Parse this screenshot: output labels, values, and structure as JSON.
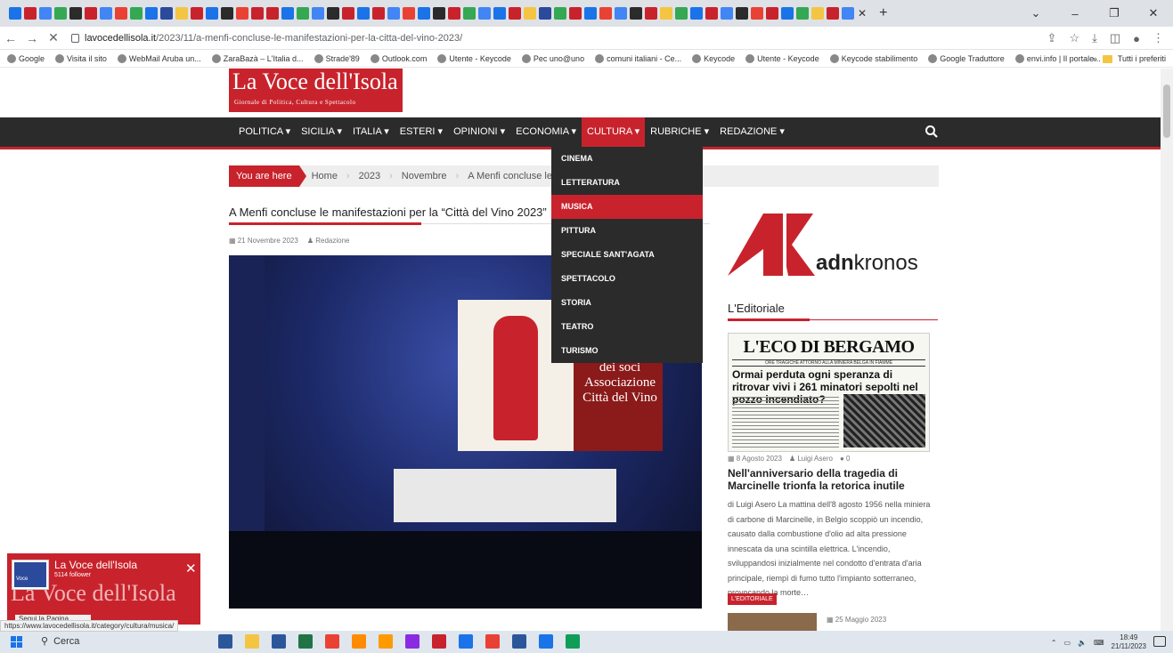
{
  "browser": {
    "url_domain": "lavocedellisola.it",
    "url_path": "/2023/11/a-menfi-concluse-le-manifestazioni-per-la-citta-del-vino-2023/",
    "tab_favicon_colors": [
      "#1a73e8",
      "#c8232c",
      "#4285f4",
      "#34a853",
      "#2b2b2b",
      "#c8232c",
      "#4285f4",
      "#e94235",
      "#34a853",
      "#1a73e8",
      "#2b4a9c",
      "#f4c542",
      "#c8232c",
      "#1a73e8",
      "#2b2b2b",
      "#e94235",
      "#c8232c",
      "#c8232c",
      "#1a73e8",
      "#34a853",
      "#4285f4",
      "#2b2b2b",
      "#c8232c",
      "#1a73e8",
      "#c8232c",
      "#4285f4",
      "#e94235",
      "#1a73e8",
      "#2b2b2b",
      "#c8232c",
      "#34a853",
      "#4285f4",
      "#1a73e8",
      "#c8232c",
      "#f4c542",
      "#2b4a9c",
      "#34a853",
      "#c8232c",
      "#1a73e8",
      "#e94235",
      "#4285f4",
      "#2b2b2b",
      "#c8232c",
      "#f4c542",
      "#34a853",
      "#1a73e8",
      "#c8232c",
      "#4285f4",
      "#2b2b2b",
      "#e94235",
      "#c8232c",
      "#1a73e8",
      "#34a853",
      "#f4c542",
      "#c8232c",
      "#4285f4"
    ],
    "bookmarks": [
      {
        "label": "Google"
      },
      {
        "label": "Visita il sito"
      },
      {
        "label": "WebMail Aruba un..."
      },
      {
        "label": "ZaraBazà – L'Italia d..."
      },
      {
        "label": "Strade'89"
      },
      {
        "label": "Outlook.com"
      },
      {
        "label": "Utente - Keycode"
      },
      {
        "label": "Pec uno@uno"
      },
      {
        "label": "comuni italiani - Ce..."
      },
      {
        "label": "Keycode"
      },
      {
        "label": "Utente - Keycode"
      },
      {
        "label": "Keycode stabilimento"
      },
      {
        "label": "Google Traduttore"
      },
      {
        "label": "envi.info | Il portale..."
      }
    ],
    "all_bookmarks_label": "Tutti i preferiti",
    "status_url": "https://www.lavocedellisola.it/category/cultura/musica/"
  },
  "site": {
    "logo_title": "La Voce dell'Isola",
    "logo_subtitle": "Giornale di Politica, Cultura e Spettacolo",
    "nav": [
      {
        "label": "POLITICA ▾",
        "active": false
      },
      {
        "label": "SICILIA ▾",
        "active": false
      },
      {
        "label": "ITALIA ▾",
        "active": false
      },
      {
        "label": "ESTERI ▾",
        "active": false
      },
      {
        "label": "OPINIONI ▾",
        "active": false
      },
      {
        "label": "ECONOMIA ▾",
        "active": false
      },
      {
        "label": "CULTURA ▾",
        "active": true
      },
      {
        "label": "RUBRICHE ▾",
        "active": false
      },
      {
        "label": "REDAZIONE ▾",
        "active": false
      }
    ],
    "cultura_menu": [
      {
        "label": "CINEMA",
        "active": false
      },
      {
        "label": "LETTERATURA",
        "active": false
      },
      {
        "label": "MUSICA",
        "active": true
      },
      {
        "label": "PITTURA",
        "active": false
      },
      {
        "label": "SPECIALE SANT'AGATA",
        "active": false
      },
      {
        "label": "SPETTACOLO",
        "active": false
      },
      {
        "label": "STORIA",
        "active": false
      },
      {
        "label": "TEATRO",
        "active": false
      },
      {
        "label": "TURISMO",
        "active": false
      }
    ],
    "accent_color": "#c8232c",
    "nav_bg": "#2b2b2b"
  },
  "breadcrumb": {
    "you_are_here": "You are here",
    "items": [
      "Home",
      "2023",
      "Novembre",
      "A Menfi concluse le manife"
    ]
  },
  "article": {
    "title": "A Menfi concluse le manifestazioni per la “Città del Vino 2023”",
    "date": "21 Novembre 2023",
    "author": "Redazione",
    "photo_banner_text": "dei soci Associazione Città del Vino"
  },
  "sidebar": {
    "adn_bold": "adn",
    "adn_rest": "kronos",
    "section_title": "L'Editoriale",
    "newspaper": {
      "masthead": "L'ECO DI BERGAMO",
      "kicker": "ORE TRAGICHE ATTORNO ALLA MINIERA BELGA IN FIAMME",
      "headline": "Ormai perduta ogni speranza di ritrovar vivi i 261 minatori sepolti nel pozzo incendiato?"
    },
    "post_date": "8 Agosto 2023",
    "post_author": "Luigi Asero",
    "post_comments": "0",
    "post_title": "Nell'anniversario della tragedia di Marcinelle trionfa la retorica inutile",
    "post_excerpt": "di Luigi Asero La mattina dell'8 agosto 1956 nella miniera di carbone di Marcinelle, in Belgio scoppiò un incendio, causato dalla combustione d'olio ad alta pressione innescata da una scintilla elettrica. L'incendio, sviluppandosi inizialmente nel condotto d'entrata d'aria principale, riempì di fumo tutto l'impianto sotterraneo, provocando la morte…",
    "post_category": "L'EDITORIALE",
    "next_date": "25 Maggio 2023"
  },
  "fb_widget": {
    "name": "La Voce dell'Isola",
    "followers": "5114 follower",
    "big_title": "La Voce dell'Isola",
    "follow_label": "Segui la Pagina",
    "thumb_label": "Voce"
  },
  "taskbar": {
    "search_label": "Cerca",
    "time": "18:49",
    "date": "21/11/2023",
    "app_colors": [
      "#2b579a",
      "#f4c542",
      "#2b579a",
      "#217346",
      "#e94235",
      "#ff8c00",
      "#ff9a00",
      "#8a2be2",
      "#c8232c",
      "#1a73e8",
      "#e94235",
      "#2b579a",
      "#1a73e8",
      "#0f9d58"
    ]
  }
}
